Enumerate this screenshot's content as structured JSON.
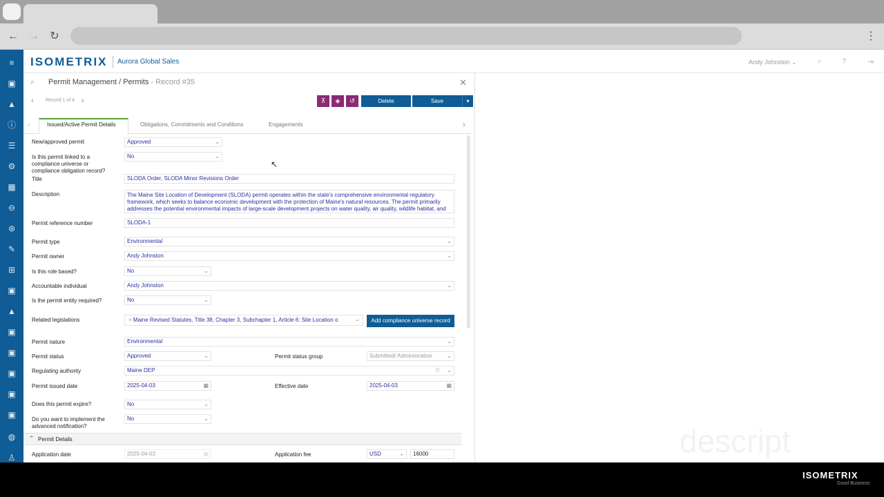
{
  "app": {
    "logo": "ISOMETRIX",
    "company": "Aurora Global Sales",
    "user": "Andy Johnston",
    "footer_logo": "ISOMETRIX",
    "footer_tagline": "Good Business",
    "watermark": "descript"
  },
  "record": {
    "breadcrumb": "Permit Management / Permits",
    "record_id": " - Record #35",
    "nav": "Record 1 of 4",
    "delete_label": "Delete",
    "save_label": "Save"
  },
  "tabs": [
    {
      "label": "Issued/Active Permit Details",
      "active": true
    },
    {
      "label": "Obligations, Commitments and Conditions",
      "active": false
    },
    {
      "label": "Engagements",
      "active": false
    }
  ],
  "form": {
    "new_approved_label": "New/approved permit",
    "new_approved_value": "Approved",
    "linked_label": "Is this permit linked to a compliance universe or compliance obligation record?",
    "linked_value": "No",
    "title_label": "Title",
    "title_value": "SLODA Order, SLODA Minor Revisions Order",
    "description_label": "Description",
    "description_value": "The Maine Site Location of Development (SLODA) permit operates within the state's comprehensive environmental regulatory framework, which seeks to balance economic development with the protection of Maine's natural resources. The permit primarily addresses the potential environmental impacts of large-scale development projects on water quality, air quality, wildlife habitat, and other critical ecological resources.",
    "ref_label": "Permit reference number",
    "ref_value": "SLODA-1",
    "type_label": "Permit type",
    "type_value": "Environmental",
    "owner_label": "Permit owner",
    "owner_value": "Andy Johnston",
    "role_label": "Is this role based?",
    "role_value": "No",
    "accountable_label": "Accountable individual",
    "accountable_value": "Andy Johnston",
    "entity_label": "Is the permit entity required?",
    "entity_value": "No",
    "legislation_label": "Related legislations",
    "legislation_value": "Maine Revised Statutes, Title 38, Chapter 3, Subchapter 1, Article 6: Site Location o",
    "add_compliance_label": "Add compliance universe record",
    "nature_label": "Permit nature",
    "nature_value": "Environmental",
    "status_label": "Permit status",
    "status_value": "Approved",
    "status_group_label": "Permit status group",
    "status_group_value": "Submitted/ Administration",
    "authority_label": "Regulating authority",
    "authority_value": "Maine DEP",
    "issued_label": "Permit issued date",
    "issued_value": "2025-04-03",
    "effective_label": "Effective date",
    "effective_value": "2025-04-03",
    "expire_label": "Does this permit expire?",
    "expire_value": "No",
    "notification_label": "Do you want to implement the advanced notification?",
    "notification_value": "No",
    "section_label": "Permit Details",
    "app_date_label": "Application date",
    "app_date_value": "2025-04-03",
    "app_fee_label": "Application fee",
    "currency_value": "USD",
    "fee_value": "16000"
  }
}
